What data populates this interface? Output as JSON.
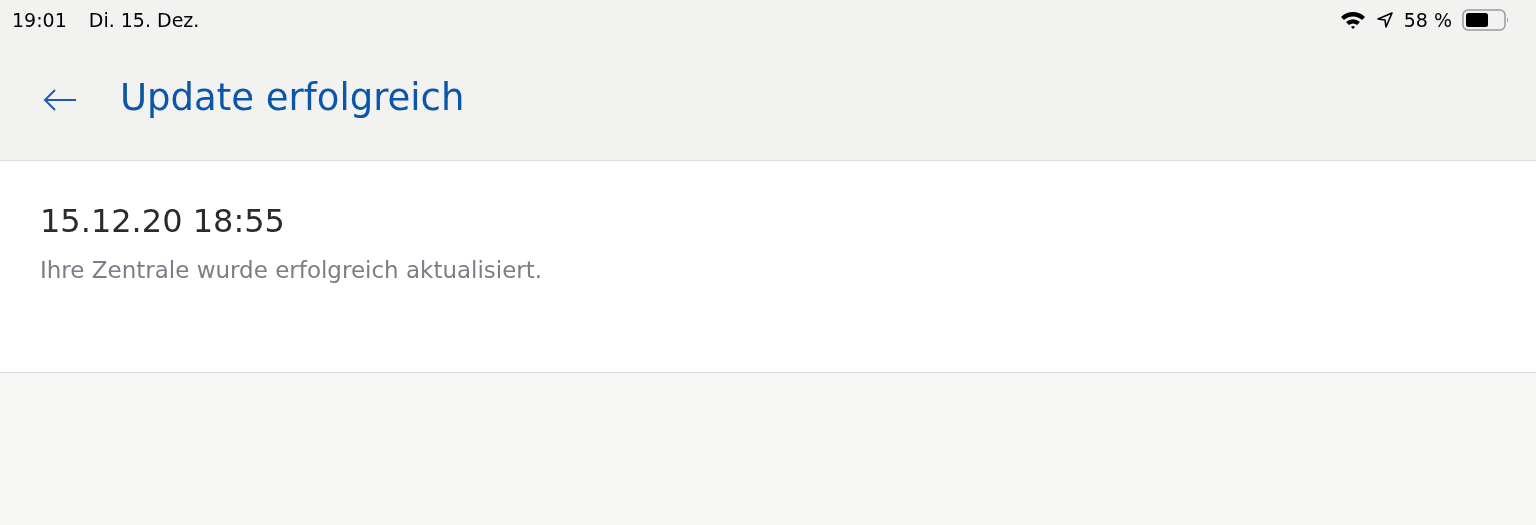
{
  "status_bar": {
    "time": "19:01",
    "date": "Di. 15. Dez.",
    "battery": "58 %"
  },
  "header": {
    "title": "Update erfolgreich"
  },
  "messages": [
    {
      "timestamp": "15.12.20 18:55",
      "text": "Ihre Zentrale wurde erfolgreich aktualisiert."
    }
  ]
}
